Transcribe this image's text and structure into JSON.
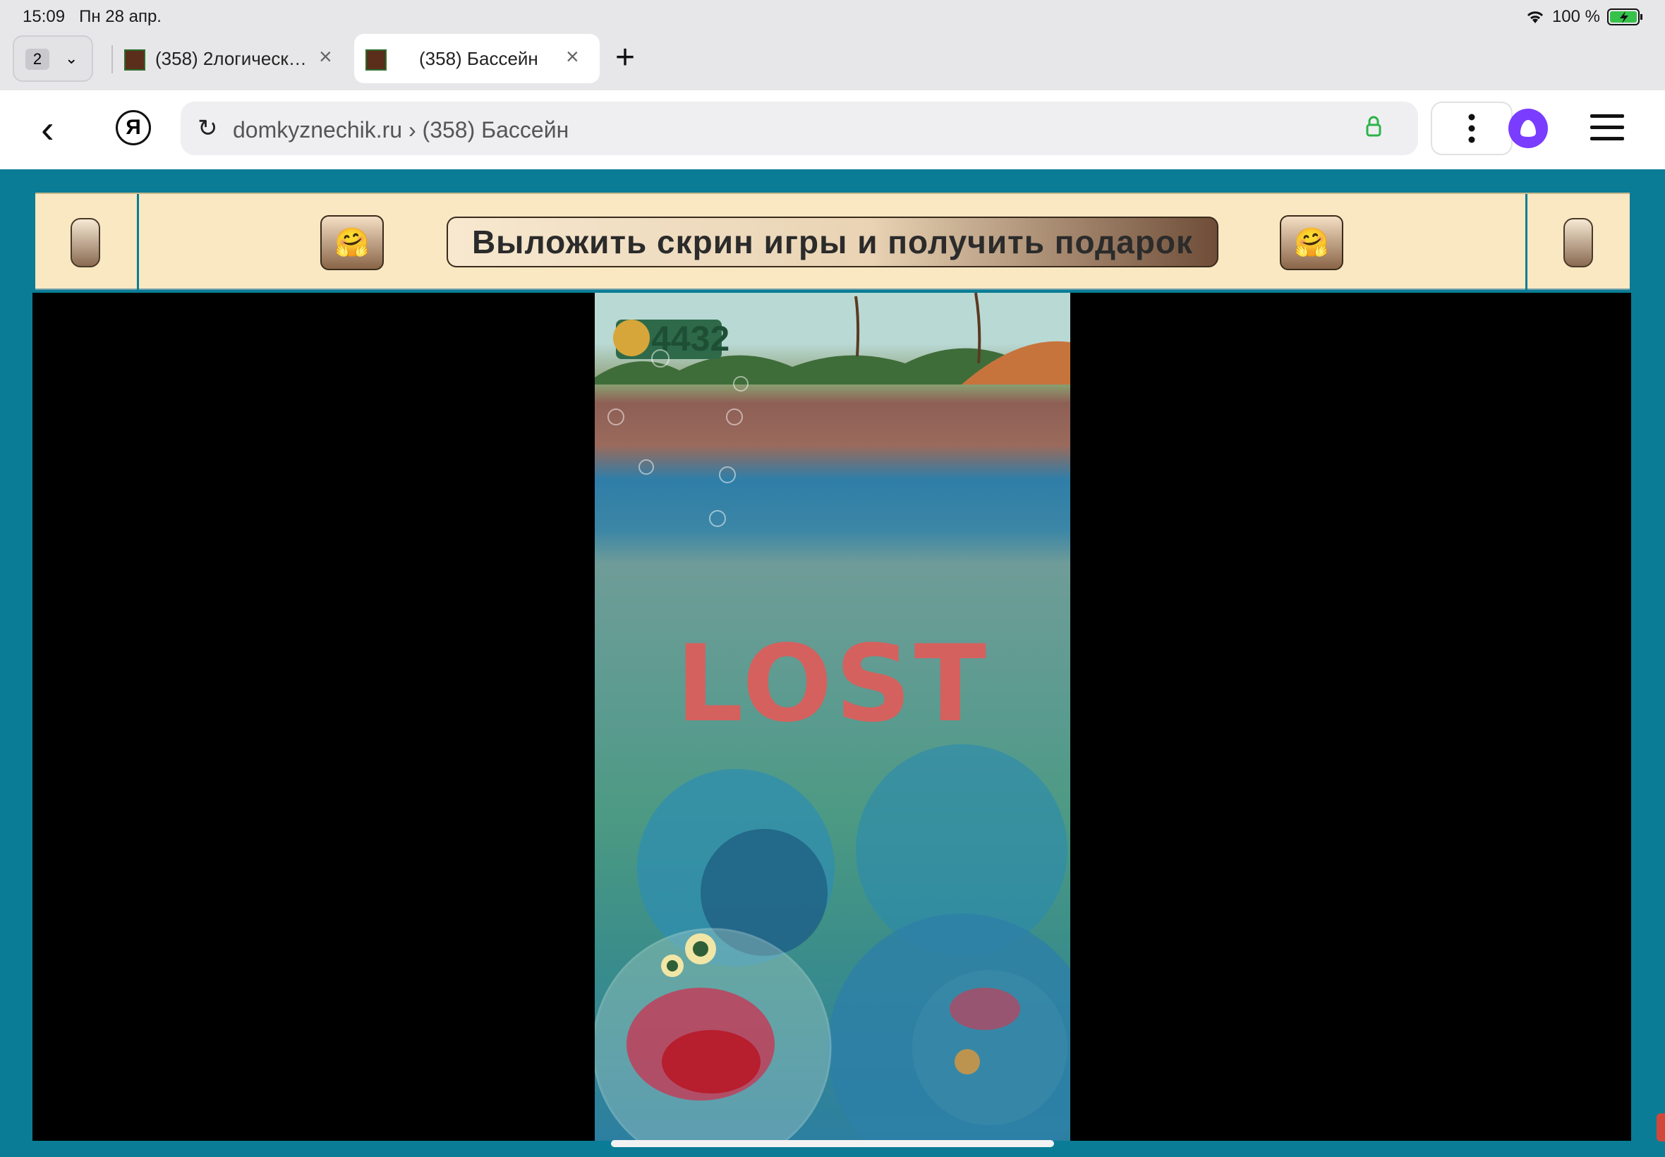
{
  "status_bar": {
    "time": "15:09",
    "date": "Пн 28 апр.",
    "battery": "100 %"
  },
  "tabs": {
    "count": "2",
    "items": [
      {
        "label": "(358) 2логическ…"
      },
      {
        "label": "(358) Бассейн"
      }
    ]
  },
  "address_bar": {
    "url": "domkyznechik.ru › (358) Бассейн"
  },
  "banner": {
    "cta": "Выложить скрин игры и получить подарок",
    "emoji": "🤗"
  },
  "game": {
    "score": "4432",
    "message": "LOST"
  },
  "icons": {
    "wifi": "wifi-icon",
    "battery": "battery-charging-icon",
    "back": "chevron-left-icon",
    "yandex": "yandex-logo-icon",
    "reload": "reload-icon",
    "lock": "lock-icon",
    "more": "more-vertical-icon",
    "alice": "alice-icon",
    "menu": "hamburger-icon"
  },
  "colors": {
    "page_bg": "#0a7c96",
    "banner_bg": "#f9e8c1",
    "lost_text": "#d4615e",
    "alice": "#7a3cff",
    "lock": "#2bb34a"
  }
}
